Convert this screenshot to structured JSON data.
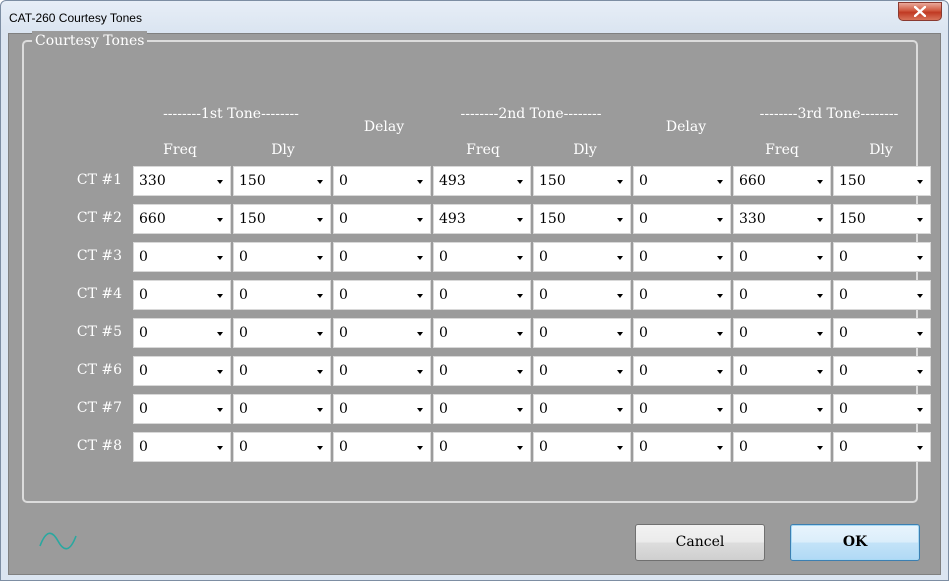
{
  "window": {
    "title": "CAT-260 Courtesy Tones"
  },
  "group": {
    "legend": "Courtesy Tones"
  },
  "headers": {
    "tone1": "--------1st Tone--------",
    "tone2": "--------2nd Tone--------",
    "tone3": "--------3rd Tone--------",
    "freq": "Freq",
    "dly": "Dly",
    "delay": "Delay"
  },
  "rows": [
    {
      "label": "CT #1",
      "values": [
        "330",
        "150",
        "0",
        "493",
        "150",
        "0",
        "660",
        "150"
      ]
    },
    {
      "label": "CT #2",
      "values": [
        "660",
        "150",
        "0",
        "493",
        "150",
        "0",
        "330",
        "150"
      ]
    },
    {
      "label": "CT #3",
      "values": [
        "0",
        "0",
        "0",
        "0",
        "0",
        "0",
        "0",
        "0"
      ]
    },
    {
      "label": "CT #4",
      "values": [
        "0",
        "0",
        "0",
        "0",
        "0",
        "0",
        "0",
        "0"
      ]
    },
    {
      "label": "CT #5",
      "values": [
        "0",
        "0",
        "0",
        "0",
        "0",
        "0",
        "0",
        "0"
      ]
    },
    {
      "label": "CT #6",
      "values": [
        "0",
        "0",
        "0",
        "0",
        "0",
        "0",
        "0",
        "0"
      ]
    },
    {
      "label": "CT #7",
      "values": [
        "0",
        "0",
        "0",
        "0",
        "0",
        "0",
        "0",
        "0"
      ]
    },
    {
      "label": "CT #8",
      "values": [
        "0",
        "0",
        "0",
        "0",
        "0",
        "0",
        "0",
        "0"
      ]
    }
  ],
  "buttons": {
    "cancel": "Cancel",
    "ok": "OK"
  },
  "icons": {
    "close": "close-icon",
    "wave": "sine-wave-icon"
  },
  "colors": {
    "panel": "#9b9b9b",
    "wave": "#2aa8a0"
  }
}
